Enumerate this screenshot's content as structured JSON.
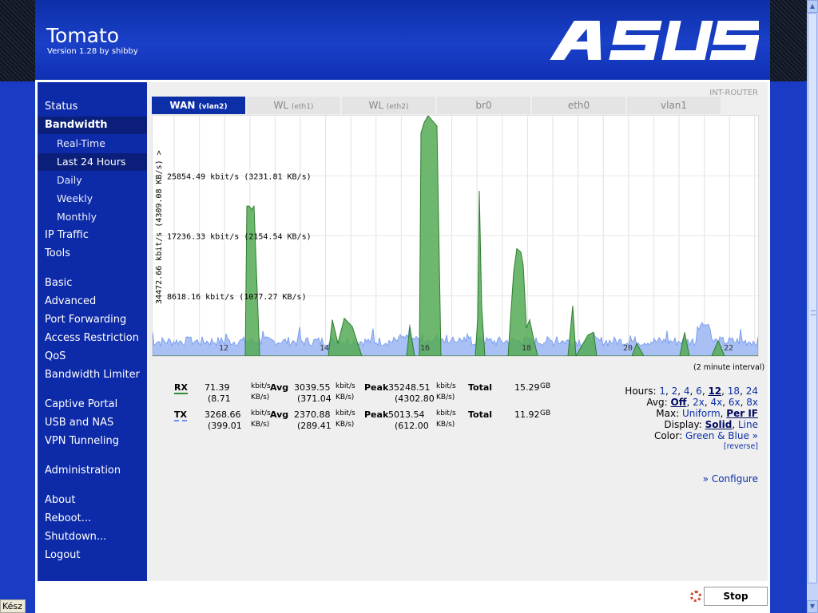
{
  "header": {
    "title": "Tomato",
    "version": "Version 1.28 by shibby",
    "brand": "ASUS"
  },
  "sidebar": {
    "items": [
      {
        "label": "Status"
      },
      {
        "label": "Bandwidth",
        "active": true
      },
      {
        "label": "Real-Time",
        "sub": true
      },
      {
        "label": "Last 24 Hours",
        "sub": true,
        "active": true
      },
      {
        "label": "Daily",
        "sub": true
      },
      {
        "label": "Weekly",
        "sub": true
      },
      {
        "label": "Monthly",
        "sub": true
      },
      {
        "label": "IP Traffic"
      },
      {
        "label": "Tools"
      },
      {
        "label": "Basic"
      },
      {
        "label": "Advanced"
      },
      {
        "label": "Port Forwarding"
      },
      {
        "label": "Access Restriction"
      },
      {
        "label": "QoS"
      },
      {
        "label": "Bandwidth Limiter"
      },
      {
        "label": "Captive Portal"
      },
      {
        "label": "USB and NAS"
      },
      {
        "label": "VPN Tunneling"
      },
      {
        "label": "Administration"
      },
      {
        "label": "About"
      },
      {
        "label": "Reboot..."
      },
      {
        "label": "Shutdown..."
      },
      {
        "label": "Logout"
      }
    ]
  },
  "content": {
    "router_name": "INT-ROUTER",
    "tabs": [
      {
        "label": "WAN",
        "sub": "(vlan2)",
        "active": true
      },
      {
        "label": "WL",
        "sub": "(eth1)"
      },
      {
        "label": "WL",
        "sub": "(eth2)"
      },
      {
        "label": "br0",
        "sub": ""
      },
      {
        "label": "eth0",
        "sub": ""
      },
      {
        "label": "vlan1",
        "sub": ""
      }
    ],
    "interval": "(2 minute interval)",
    "stats": {
      "rx": {
        "label": "RX",
        "rate": "71.39",
        "rate_unit": "kbit/s",
        "rate_kb": "(8.71",
        "rate_kb_unit": "KB/s)",
        "avg_label": "Avg",
        "avg": "3039.55",
        "avg_unit": "kbit/s",
        "avg_kb": "(371.04",
        "avg_kb_unit": "KB/s)",
        "peak_label": "Peak",
        "peak": "35248.51",
        "peak_unit": "kbit/s",
        "peak_kb": "(4302.80",
        "peak_kb_unit": "KB/s)",
        "total_label": "Total",
        "total": "15.29",
        "total_unit": "GB"
      },
      "tx": {
        "label": "TX",
        "rate": "3268.66",
        "rate_unit": "kbit/s",
        "rate_kb": "(399.01",
        "rate_kb_unit": "KB/s)",
        "avg_label": "Avg",
        "avg": "2370.88",
        "avg_unit": "kbit/s",
        "avg_kb": "(289.41",
        "avg_kb_unit": "KB/s)",
        "peak_label": "Peak",
        "peak": "5013.54",
        "peak_unit": "kbit/s",
        "peak_kb": "(612.00",
        "peak_kb_unit": "KB/s)",
        "total_label": "Total",
        "total": "11.92",
        "total_unit": "GB"
      }
    },
    "options": {
      "hours_label": "Hours:",
      "hours": [
        "1",
        "2",
        "4",
        "6",
        "12",
        "18",
        "24"
      ],
      "hours_selected": "12",
      "avg_label": "Avg:",
      "avg": [
        "Off",
        "2x",
        "4x",
        "6x",
        "8x"
      ],
      "avg_selected": "Off",
      "max_label": "Max:",
      "max": [
        "Uniform",
        "Per IF"
      ],
      "max_selected": "Per IF",
      "display_label": "Display:",
      "display": [
        "Solid",
        "Line"
      ],
      "display_selected": "Solid",
      "color_label": "Color:",
      "color_value": "Green & Blue »",
      "reverse": "[reverse]"
    },
    "configure": "» Configure"
  },
  "footer": {
    "stop_button": "Stop"
  },
  "statusbar": {
    "text": "Kész"
  },
  "chart_data": {
    "type": "area",
    "y_axis_label": "34472.66 kbit/s (4309.08 KB/s) >",
    "gridline_labels": [
      "25854.49 kbit/s (3231.81 KB/s)",
      "17236.33 kbit/s (2154.54 KB/s)",
      "8618.16 kbit/s (1077.27 KB/s)"
    ],
    "gridline_values": [
      25854.49,
      17236.33,
      8618.16
    ],
    "ylim": [
      0,
      34472.66
    ],
    "x_ticks": [
      "12",
      "14",
      "16",
      "18",
      "20",
      "22"
    ],
    "series": [
      {
        "name": "RX",
        "color": "#3a9a3a",
        "values": [
          0,
          0,
          0,
          0,
          0,
          0,
          0,
          0,
          0,
          0,
          0,
          0,
          0,
          0,
          0,
          0,
          0,
          0,
          0,
          0,
          0,
          0,
          0,
          0,
          0,
          0,
          0,
          0,
          0,
          0,
          0,
          0,
          0,
          0,
          0,
          0,
          0,
          0,
          0,
          0,
          0,
          0,
          0,
          0,
          0,
          0,
          0,
          0,
          0,
          0,
          0,
          0,
          0,
          0,
          0,
          0,
          0,
          0,
          0,
          0,
          0,
          0,
          0,
          0,
          0,
          0,
          0,
          0,
          0,
          0,
          0,
          0,
          0,
          0,
          0,
          0,
          0,
          0,
          0,
          0,
          0,
          0,
          0,
          0,
          0,
          0,
          0,
          0,
          0,
          0,
          0,
          0,
          0,
          0,
          0,
          0,
          0,
          0,
          0,
          0,
          0,
          0,
          0,
          0,
          0,
          0,
          0,
          0,
          0,
          0,
          0,
          0,
          0,
          0,
          0,
          0,
          0,
          0,
          0,
          0,
          0,
          0,
          0,
          0,
          0,
          0,
          0,
          0,
          0,
          0,
          0,
          0,
          0,
          0,
          0,
          0,
          0,
          0,
          0,
          0,
          0,
          0,
          0,
          0,
          0,
          0,
          0,
          0,
          0,
          0,
          0,
          0,
          0,
          0,
          0,
          0,
          0,
          0,
          0,
          0,
          0,
          0,
          0,
          0,
          0,
          0,
          0,
          0,
          0,
          0,
          0,
          0,
          0,
          0,
          0,
          0,
          0,
          0,
          0,
          0,
          0,
          0,
          0,
          0,
          0,
          0,
          0,
          0,
          0,
          0,
          0,
          0,
          0,
          0,
          0,
          0,
          0,
          0,
          0,
          0,
          0,
          0,
          0,
          0,
          0,
          0,
          0,
          0,
          0,
          0,
          0,
          0,
          0,
          0,
          0,
          0,
          0,
          0,
          0,
          0,
          0,
          0,
          0,
          0,
          0,
          0,
          0,
          0,
          0,
          0,
          0,
          0,
          0,
          0,
          0,
          0,
          0,
          0,
          0,
          0,
          0,
          0,
          0,
          0,
          0,
          0,
          0,
          0,
          0,
          0,
          0,
          0,
          0,
          0,
          0,
          0,
          0,
          0,
          0,
          0,
          0,
          0,
          0,
          0,
          0,
          0,
          0,
          0,
          0,
          0,
          0,
          0,
          0,
          0,
          0,
          0,
          0,
          0,
          0,
          0,
          0,
          0,
          0,
          0,
          0,
          0,
          0,
          0,
          0,
          0,
          0,
          0,
          0,
          0,
          0,
          0,
          0,
          0,
          0,
          0,
          0,
          0,
          0,
          0,
          0,
          0,
          0,
          0,
          0,
          0,
          0,
          0,
          0,
          0,
          0,
          0,
          0,
          0,
          0,
          0,
          0,
          0,
          0,
          0,
          0,
          0,
          0,
          0,
          0,
          0,
          0,
          0,
          0,
          0,
          0,
          0,
          0,
          0,
          0,
          0,
          0,
          0,
          0,
          0,
          0,
          0
        ]
      },
      {
        "name": "TX",
        "color": "#6f95f0",
        "values": []
      }
    ]
  }
}
